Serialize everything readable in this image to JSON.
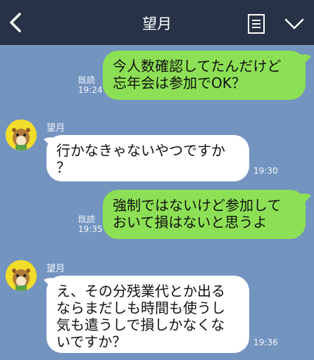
{
  "header": {
    "title": "望月",
    "back_icon": "chevron-left-icon",
    "menu_icon": "note-list-icon",
    "down_icon": "chevron-down-icon"
  },
  "messages": [
    {
      "side": "out",
      "lines": [
        "今人数確認してたんだけど",
        "忘年会は参加でOK？"
      ],
      "read": "既読",
      "time": "19:24"
    },
    {
      "side": "in",
      "sender": "望月",
      "lines": [
        "行かなきゃないやつですか",
        "？"
      ],
      "time": "19:30"
    },
    {
      "side": "out",
      "lines": [
        "強制ではないけど参加して",
        "おいて損はないと思うよ"
      ],
      "read": "既読",
      "time": "19:35"
    },
    {
      "side": "in",
      "sender": "望月",
      "lines": [
        "え、その分残業代とか出る",
        "ならまだしも時間も使うし",
        "気も遣うしで損しかなくな",
        "いですか？"
      ],
      "time": "19:36"
    }
  ],
  "colors": {
    "background": "#7494c0",
    "header": "#273246",
    "outgoing_bubble": "#8de055",
    "incoming_bubble": "#ffffff"
  }
}
